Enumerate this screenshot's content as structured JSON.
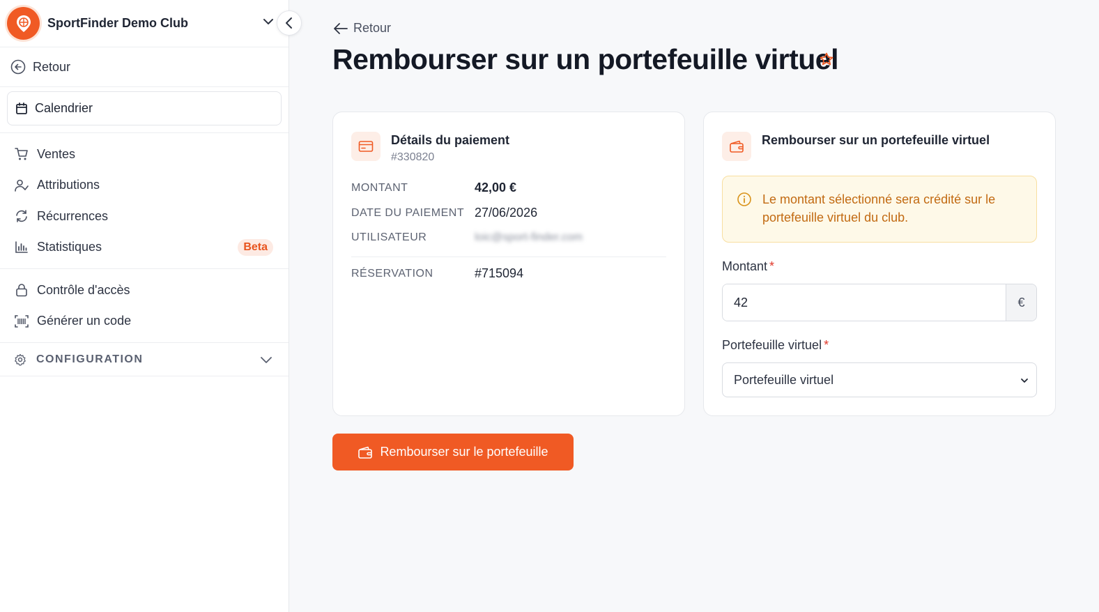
{
  "sidebar": {
    "club_name": "SportFinder Demo Club",
    "back_label": "Retour",
    "calendar_label": "Calendrier",
    "items": [
      {
        "label": "Ventes",
        "icon": "cart-icon"
      },
      {
        "label": "Attributions",
        "icon": "user-check-icon"
      },
      {
        "label": "Récurrences",
        "icon": "refresh-icon"
      },
      {
        "label": "Statistiques",
        "icon": "bar-chart-icon",
        "badge": "Beta"
      }
    ],
    "items2": [
      {
        "label": "Contrôle d'accès",
        "icon": "lock-icon"
      },
      {
        "label": "Générer un code",
        "icon": "barcode-icon"
      }
    ],
    "config_label": "CONFIGURATION"
  },
  "main": {
    "back_label": "Retour",
    "title": "Rembourser sur un portefeuille virtuel",
    "payment": {
      "title": "Détails du paiement",
      "id": "#330820",
      "rows": [
        {
          "label": "MONTANT",
          "value": "42,00 €"
        },
        {
          "label": "DATE DU PAIEMENT",
          "value": "27/06/2026"
        },
        {
          "label": "UTILISATEUR",
          "value": "loic@sport-finder.com"
        },
        {
          "label": "RÉSERVATION",
          "value": "#715094"
        }
      ]
    },
    "refund": {
      "title": "Rembourser sur un portefeuille virtuel",
      "alert": "Le montant sélectionné sera crédité sur le portefeuille virtuel du club.",
      "amount_label": "Montant",
      "amount_value": "42",
      "currency": "€",
      "wallet_label": "Portefeuille virtuel",
      "wallet_selected": "Portefeuille virtuel",
      "required_mark": "*"
    },
    "submit_label": "Rembourser sur le portefeuille"
  },
  "colors": {
    "accent": "#f05a24",
    "alert_bg": "#fef9e8",
    "alert_text": "#c26a12"
  }
}
